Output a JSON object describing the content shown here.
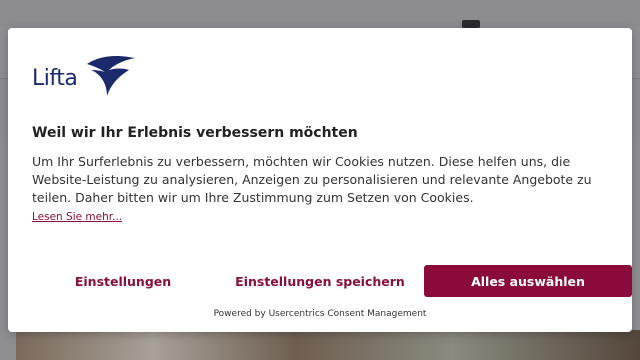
{
  "brand": {
    "name": "Lifta",
    "color": "#1b2a6b",
    "accent": "#8a0a3b"
  },
  "consent": {
    "title": "Weil wir Ihr Erlebnis verbessern möchten",
    "description": "Um Ihr Surferlebnis zu verbessern, möchten wir Cookies nutzen. Diese helfen uns, die Website-Leistung zu analysieren, Anzeigen zu personalisieren und relevante Angebote zu teilen. Daher bitten wir um Ihre Zustimmung zum Setzen von Cookies.",
    "read_more": "Lesen Sie mehr...",
    "buttons": {
      "settings": "Einstellungen",
      "save": "Einstellungen speichern",
      "accept_all": "Alles auswählen"
    },
    "powered_by": "Powered by Usercentrics Consent Management"
  }
}
